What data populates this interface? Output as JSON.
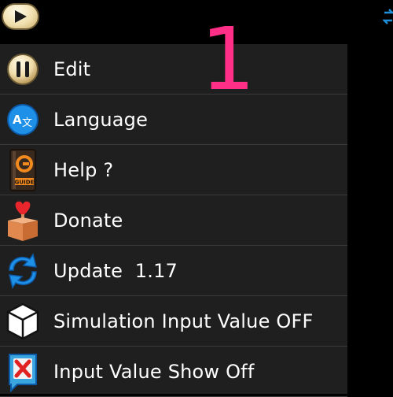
{
  "topbar": {
    "play_icon": "play-icon",
    "corner_icon": "arrow-icon"
  },
  "overlay": {
    "number": "1",
    "color": "#ff2e86"
  },
  "menu": {
    "items": [
      {
        "label": "Edit",
        "icon": "pause-icon"
      },
      {
        "label": "Language",
        "icon": "translate-icon"
      },
      {
        "label": "Help ?",
        "icon": "guide-book-icon",
        "icon_text": "GUIDE"
      },
      {
        "label": "Donate",
        "icon": "donate-box-icon"
      },
      {
        "label": "Update  1.17",
        "icon": "refresh-icon"
      },
      {
        "label": "Simulation Input Value OFF",
        "icon": "cube-icon"
      },
      {
        "label": "Input Value Show Off",
        "icon": "close-x-icon"
      }
    ],
    "colors": {
      "background": "#1f1f1f",
      "divider": "#3a3a3a",
      "text": "#ffffff"
    }
  }
}
